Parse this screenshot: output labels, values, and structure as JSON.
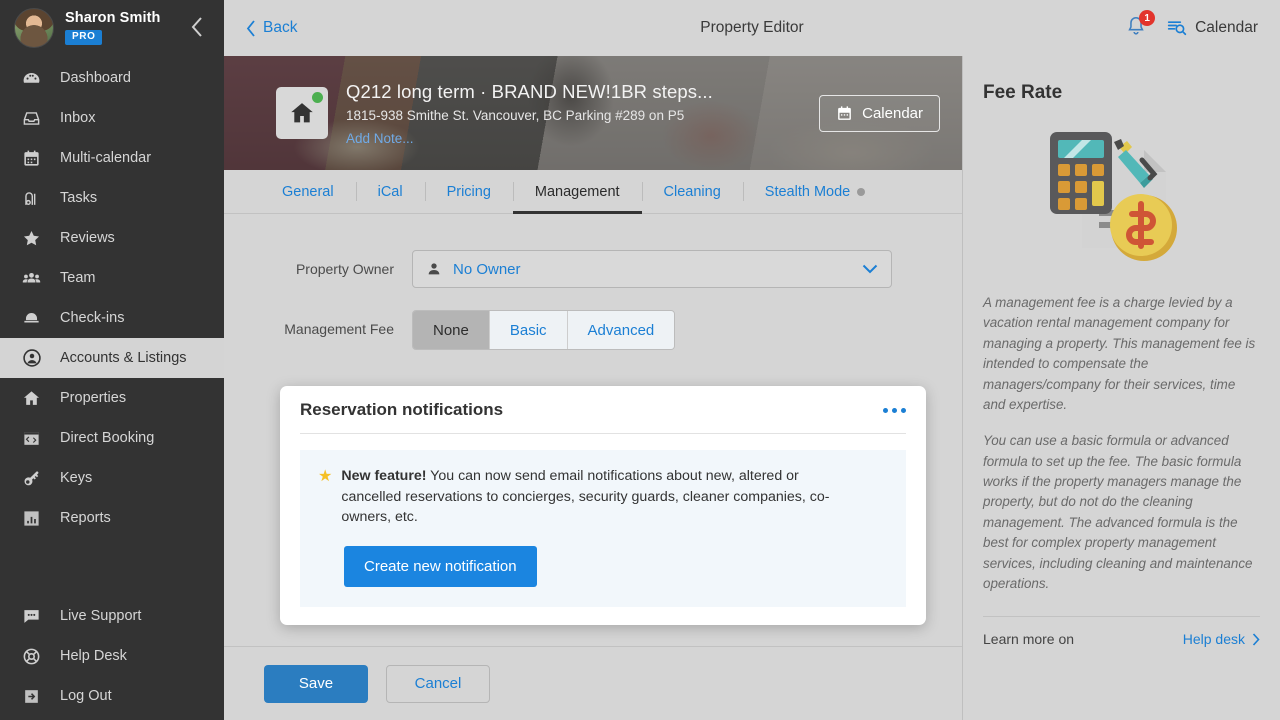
{
  "sidebar": {
    "user": {
      "name": "Sharon Smith",
      "badge": "PRO"
    },
    "collapse_icon": "chevron-left-icon",
    "items": [
      {
        "label": "Dashboard",
        "icon": "dashboard-icon",
        "active": false
      },
      {
        "label": "Inbox",
        "icon": "inbox-icon",
        "active": false
      },
      {
        "label": "Multi-calendar",
        "icon": "calendar-icon",
        "active": false
      },
      {
        "label": "Tasks",
        "icon": "vacuum-icon",
        "active": false
      },
      {
        "label": "Reviews",
        "icon": "star-icon",
        "active": false
      },
      {
        "label": "Team",
        "icon": "users-icon",
        "active": false
      },
      {
        "label": "Check-ins",
        "icon": "bell-desk-icon",
        "active": false
      },
      {
        "label": "Accounts & Listings",
        "icon": "user-circle-icon",
        "active": true
      },
      {
        "label": "Properties",
        "icon": "home-icon",
        "active": false
      },
      {
        "label": "Direct Booking",
        "icon": "code-window-icon",
        "active": false
      },
      {
        "label": "Keys",
        "icon": "key-icon",
        "active": false
      },
      {
        "label": "Reports",
        "icon": "bar-chart-icon",
        "active": false
      }
    ],
    "bottom_items": [
      {
        "label": "Live Support",
        "icon": "chat-bubble-icon"
      },
      {
        "label": "Help Desk",
        "icon": "lifebuoy-icon"
      },
      {
        "label": "Log Out",
        "icon": "logout-icon"
      }
    ]
  },
  "topbar": {
    "back_label": "Back",
    "title": "Property Editor",
    "notification_count": "1",
    "calendar_label": "Calendar"
  },
  "hero": {
    "property_title": "Q212 long term · BRAND NEW!1BR steps...",
    "address": "1815-938 Smithe St. Vancouver, BC Parking #289 on P5",
    "add_note": "Add Note...",
    "calendar_button": "Calendar",
    "status_dot_color": "#4caf50"
  },
  "tabs": [
    {
      "label": "General",
      "active": false,
      "dot": false
    },
    {
      "label": "iCal",
      "active": false,
      "dot": false
    },
    {
      "label": "Pricing",
      "active": false,
      "dot": false
    },
    {
      "label": "Management",
      "active": true,
      "dot": false
    },
    {
      "label": "Cleaning",
      "active": false,
      "dot": false
    },
    {
      "label": "Stealth Mode",
      "active": false,
      "dot": true
    }
  ],
  "form": {
    "owner_label": "Property Owner",
    "owner_value": "No Owner",
    "fee_label": "Management Fee",
    "fee_options": [
      {
        "label": "None",
        "active": true
      },
      {
        "label": "Basic",
        "active": false
      },
      {
        "label": "Advanced",
        "active": false
      }
    ]
  },
  "card": {
    "title": "Reservation notifications",
    "menu_icon": "ellipsis-icon",
    "feature_badge": "New feature!",
    "feature_text": " You can now send email notifications about new, altered or cancelled reservations to concierges, security guards, cleaner companies, co-owners, etc.",
    "cta_label": "Create new notification"
  },
  "footer": {
    "save_label": "Save",
    "cancel_label": "Cancel"
  },
  "right_panel": {
    "title": "Fee Rate",
    "illustration": "calculator-document-coin-illustration",
    "paragraph_1": "A management fee is a charge levied by a vacation rental management company for managing a property. This management fee is intended to compensate the managers/company for their services, time and expertise.",
    "paragraph_2": "You can use a basic formula or advanced formula to set up the fee. The basic formula works if the property managers manage the property, but do not do the cleaning management. The advanced formula is the best for complex property management services, including cleaning and maintenance operations.",
    "learn_more": "Learn more on",
    "help_desk": "Help desk"
  },
  "colors": {
    "accent_blue": "#1b7fd4",
    "sidebar_bg": "#333333",
    "page_bg": "#d5d5d5",
    "badge_red": "#e2342c",
    "status_green": "#4caf50"
  }
}
